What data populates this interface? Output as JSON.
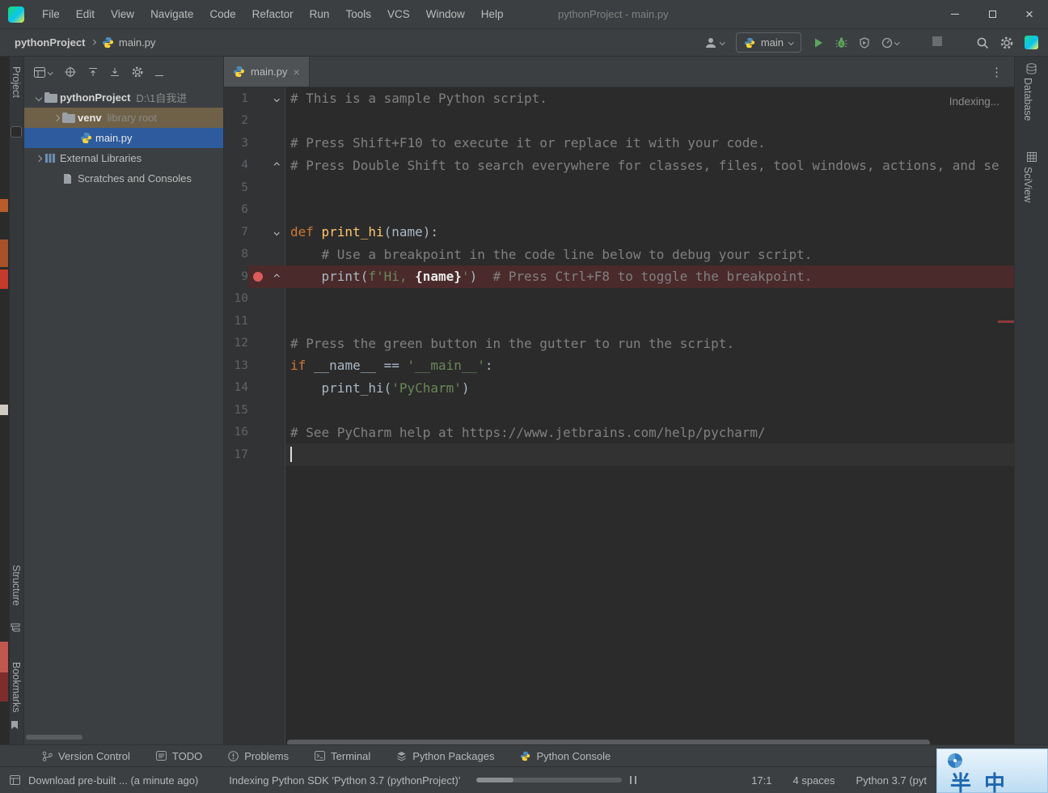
{
  "window": {
    "title": "pythonProject - main.py"
  },
  "menus": [
    "File",
    "Edit",
    "View",
    "Navigate",
    "Code",
    "Refactor",
    "Run",
    "Tools",
    "VCS",
    "Window",
    "Help"
  ],
  "navbar": {
    "project": "pythonProject",
    "file": "main.py",
    "branch": "main"
  },
  "left_stripe": {
    "labels": [
      "Project",
      "Structure",
      "Bookmarks"
    ]
  },
  "right_stripe": {
    "labels": [
      "Database",
      "SciView"
    ]
  },
  "project_panel": {
    "tree": [
      {
        "name": "pythonProject",
        "detail": "D:\\1自我进",
        "icon": "folder",
        "chevron": "down",
        "indent": 0,
        "bold": true
      },
      {
        "name": "venv",
        "detail": "library root",
        "icon": "folder",
        "chevron": "right",
        "indent": 1,
        "bold": true,
        "highlight": "tan"
      },
      {
        "name": "main.py",
        "icon": "python",
        "indent": 2,
        "highlight": "blue"
      },
      {
        "name": "External Libraries",
        "icon": "library",
        "chevron": "right",
        "indent": 0
      },
      {
        "name": "Scratches and Consoles",
        "icon": "scratches",
        "indent": 1
      }
    ]
  },
  "editor": {
    "tab": "main.py",
    "indexing": "Indexing...",
    "lines": [
      {
        "n": 1,
        "fold": "down",
        "tokens": [
          [
            "# This is a sample Python script.",
            "c"
          ]
        ]
      },
      {
        "n": 2,
        "tokens": []
      },
      {
        "n": 3,
        "tokens": [
          [
            "# Press Shift+F10 to execute it or replace it with your code.",
            "c"
          ]
        ]
      },
      {
        "n": 4,
        "fold": "up",
        "tokens": [
          [
            "# Press Double Shift to search everywhere for classes, files, tool windows, actions, and se",
            "c"
          ]
        ]
      },
      {
        "n": 5,
        "tokens": []
      },
      {
        "n": 6,
        "tokens": []
      },
      {
        "n": 7,
        "fold": "down",
        "tokens": [
          [
            "def ",
            "k"
          ],
          [
            "print_hi",
            "f"
          ],
          [
            "(name):",
            "p"
          ]
        ]
      },
      {
        "n": 8,
        "tokens": [
          [
            "    # Use a breakpoint in the code line below to debug your script.",
            "c"
          ]
        ]
      },
      {
        "n": 9,
        "fold": "up",
        "breakpoint": true,
        "tokens": [
          [
            "    print(",
            "p"
          ],
          [
            "f'Hi, ",
            "s"
          ],
          [
            "{name}",
            "b"
          ],
          [
            "'",
            "s"
          ],
          [
            ")  ",
            "p"
          ],
          [
            "# Press Ctrl+F8 to toggle the breakpoint.",
            "c"
          ]
        ]
      },
      {
        "n": 10,
        "tokens": []
      },
      {
        "n": 11,
        "tokens": []
      },
      {
        "n": 12,
        "tokens": [
          [
            "# Press the green button in the gutter to run the script.",
            "c"
          ]
        ]
      },
      {
        "n": 13,
        "tokens": [
          [
            "if ",
            "k"
          ],
          [
            "__name__ == ",
            "p"
          ],
          [
            "'__main__'",
            "s"
          ],
          [
            ":",
            "p"
          ]
        ]
      },
      {
        "n": 14,
        "tokens": [
          [
            "    print_hi(",
            "p"
          ],
          [
            "'PyCharm'",
            "s"
          ],
          [
            ")",
            "p"
          ]
        ]
      },
      {
        "n": 15,
        "tokens": []
      },
      {
        "n": 16,
        "tokens": [
          [
            "# See PyCharm help at https://www.jetbrains.com/help/pycharm/",
            "c"
          ]
        ]
      },
      {
        "n": 17,
        "current": true,
        "cursor": true,
        "tokens": []
      }
    ]
  },
  "bottom_bar": {
    "items": [
      {
        "label": "Version Control",
        "icon": "vcs"
      },
      {
        "label": "TODO",
        "icon": "todo"
      },
      {
        "label": "Problems",
        "icon": "problems"
      },
      {
        "label": "Terminal",
        "icon": "terminal"
      },
      {
        "label": "Python Packages",
        "icon": "packages"
      },
      {
        "label": "Python Console",
        "icon": "pyconsole"
      }
    ]
  },
  "status_bar": {
    "download": "Download pre-built ... (a minute ago)",
    "indexing": "Indexing Python SDK 'Python 3.7 (pythonProject)'",
    "caret": "17:1",
    "indent": "4 spaces",
    "interpreter": "Python 3.7 (pyt"
  },
  "ime": {
    "chars": [
      "半",
      "中"
    ]
  },
  "icons": {
    "close": "×",
    "more_vertical": "⋮"
  },
  "colors": {
    "panel_bg": "#3c3f41",
    "editor_bg": "#2b2b2b",
    "selection_blue": "#2d5b9e",
    "hover_tan": "#6e6147",
    "breakpoint_red": "#db5c5c",
    "breakpoint_line": "#4a2a2a",
    "keyword_orange": "#cc7832",
    "function_yellow": "#ffc66d",
    "string_green": "#6a8759",
    "comment_gray": "#808080",
    "run_green": "#5ca75c"
  }
}
